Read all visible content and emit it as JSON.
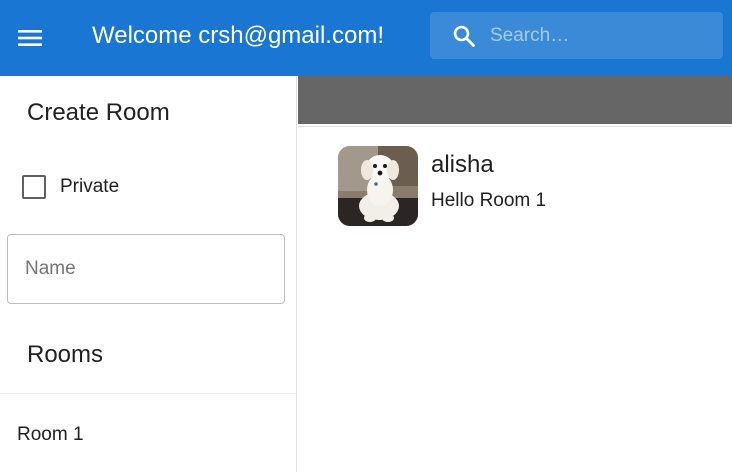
{
  "header": {
    "welcome_text": "Welcome crsh@gmail.com!",
    "menu_icon": "menu-icon",
    "search": {
      "placeholder": "Search…",
      "value": "",
      "icon": "search-icon"
    },
    "color": "#1976d2"
  },
  "sidebar": {
    "create_room_title": "Create Room",
    "private_checkbox": {
      "label": "Private",
      "checked": false
    },
    "name_field": {
      "placeholder": "Name",
      "value": ""
    },
    "rooms_title": "Rooms",
    "rooms": [
      {
        "label": "Room 1"
      }
    ]
  },
  "main": {
    "messages": [
      {
        "author": "alisha",
        "text": "Hello Room 1",
        "avatar": "dog-avatar"
      }
    ]
  }
}
